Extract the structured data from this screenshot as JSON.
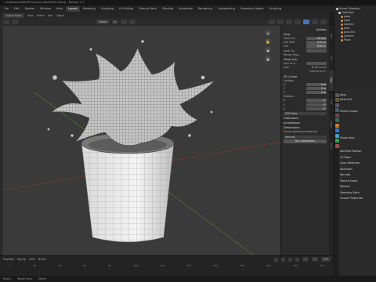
{
  "window": {
    "title": "...ted/Downloads/MFC/create splash/002.blend] - Blender 4.1"
  },
  "workspaces": [
    "File",
    "Edit",
    "Render",
    "Window",
    "Help",
    "Layout",
    "Modeling",
    "Sculpting",
    "UV Editing",
    "Texture Paint",
    "Shading",
    "Animation",
    "Rendering",
    "Compositing",
    "Geometry Nodes",
    "Scripting"
  ],
  "active_workspace_index": 5,
  "viewport_menu": [
    "Object Mode",
    "View",
    "Select",
    "Add",
    "Object"
  ],
  "viewport_header": {
    "orientation": "Global",
    "pivot": "⊙"
  },
  "scene": {
    "label": "Scene",
    "view_layer": "ViewLayer"
  },
  "options_label": "Options",
  "npanel": {
    "view_header": "View",
    "focal_length_label": "Focal Len...",
    "focal_length_value": "50 mm",
    "clip_start_label": "Clip Start",
    "clip_start_value": "0.01 m",
    "clip_end_label": "End",
    "clip_end_value": "1000 m",
    "local_camera_label": "Local Ca...",
    "render_region_label": "Render Regi...",
    "view_lock_header": "View Lock",
    "lock_to_object_label": "Lock to O...",
    "lock_label": "Lock",
    "to_3d_cursor": "To 3D Cursor",
    "camera_to_view": "Camera to V...",
    "cursor_header": "3D Cursor",
    "location_label": "Location",
    "loc_x": "0 m",
    "loc_y": "0 m",
    "loc_z": "0 m",
    "rotation_label": "Rotation",
    "rot_x": "0°",
    "rot_y": "0°",
    "rot_z": "0°",
    "rotation_mode": "XYZ Euler",
    "collections_header": "Collections",
    "annotations_header": "Annotations",
    "dimensions_header": "Dimensions",
    "geometry_nodes_label": "Source geometry/rendering",
    "new_set_label": "New set",
    "run_button": "Run coordinates"
  },
  "npanel_tabs": [
    "Item",
    "Tool",
    "View",
    "Edit",
    "Create",
    "Draw"
  ],
  "outliner": {
    "title": "Scene Collection",
    "items": [
      {
        "label": "Scene Collection",
        "color": "#cfcfcf"
      },
      {
        "label": "Collection",
        "color": "#cfcfcf"
      },
      {
        "label": "glass",
        "color": "#e08a2c"
      },
      {
        "label": "Light",
        "color": "#e08a2c"
      },
      {
        "label": "Camera",
        "color": "#e08a2c"
      },
      {
        "label": "Area",
        "color": "#e08a2c"
      },
      {
        "label": "Area.001",
        "color": "#e08a2c"
      },
      {
        "label": "Camera",
        "color": "#e08a2c"
      },
      {
        "label": "Plane",
        "color": "#e08a2c"
      }
    ]
  },
  "properties": {
    "object_name": "glass",
    "mesh_name": "Mesh.002",
    "sections": [
      "Vertex Groups",
      "Shape Keys",
      "UV Maps",
      "Color Attributes",
      "Attributes",
      "Normals",
      "Texture Space",
      "Remesh",
      "Geometry Data",
      "Custom Properties"
    ],
    "add_rest_position": "Add Rest Position"
  },
  "timeline": {
    "menu": [
      "Playback",
      "Keying",
      "View",
      "Marker"
    ],
    "frame_start": "1",
    "frame_end": "250",
    "current_frame": "1",
    "ruler": [
      "0",
      "20",
      "40",
      "60",
      "80",
      "100",
      "120",
      "140",
      "160",
      "180",
      "200",
      "220",
      "240"
    ]
  },
  "status": {
    "left": "Select",
    "middle": "Rotate View",
    "right": "Object"
  }
}
